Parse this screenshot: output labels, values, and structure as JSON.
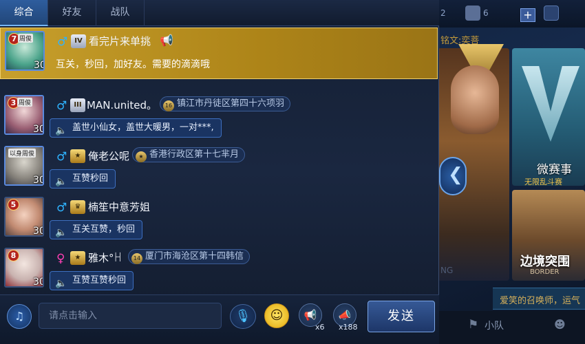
{
  "tabs": [
    {
      "label": "综合",
      "active": true
    },
    {
      "label": "好友",
      "active": false
    },
    {
      "label": "战队",
      "active": false
    }
  ],
  "top_right": {
    "count_a": "2",
    "count_b": "6"
  },
  "lobby": {
    "inscription_label": "铭文:奕菩",
    "tournament_title": "微赛事",
    "tournament_sub": "无限乱斗赛",
    "frontier_title": "边境突围",
    "frontier_en": "BORDER",
    "hidden_word": "赛",
    "hidden_en": "NG",
    "summoner_notice": "爱笑的召唤师，运气",
    "squad_label": "小队"
  },
  "messages": [
    {
      "highlight": true,
      "avatar_level": "30",
      "avatar_tag": "周俊",
      "rank_badge": "7",
      "gender": "♂",
      "gender_color": "#2fb3ff",
      "rank_icon": "IV",
      "nickname": "看完片来单挑",
      "text": "互关，秒回，加好友。需要的滴滴哦"
    },
    {
      "highlight": false,
      "avatar_level": "30",
      "avatar_tag": "周俊",
      "rank_badge": "3",
      "gender": "♂",
      "gender_color": "#2fb3ff",
      "rank_icon": "III",
      "nickname": "MAN.united。",
      "location_icon": "16",
      "location": "镇江市丹徒区第四十六项羽",
      "text": "盖世小仙女，盖世大暖男，一对***,"
    },
    {
      "highlight": false,
      "avatar_level": "30",
      "avatar_tag": "以身周俊",
      "rank_badge": "",
      "gender": "♂",
      "gender_color": "#2fb3ff",
      "rank_icon": "★",
      "nickname": "俺老公呢",
      "location_icon": "★",
      "location": "香港行政区第十七芈月",
      "text": "互赞秒回"
    },
    {
      "highlight": false,
      "avatar_level": "30",
      "avatar_tag": "",
      "rank_badge": "5",
      "gender": "♂",
      "gender_color": "#2fb3ff",
      "rank_icon": "♛",
      "nickname": "楠笙中意芳姐",
      "text": "互关互赞，秒回"
    },
    {
      "highlight": false,
      "avatar_level": "30",
      "avatar_tag": "",
      "rank_badge": "8",
      "gender": "♀",
      "gender_color": "#ff3fb4",
      "rank_icon": "★",
      "nickname": "雅木°ꀿ",
      "location_icon": "14",
      "location": "厦门市海沧区第十四韩信",
      "text": "互赞互赞秒回"
    }
  ],
  "input": {
    "placeholder": "请点击输入",
    "send_label": "发送",
    "horn_small_count": "x6",
    "horn_large_count": "x188"
  },
  "colors": {
    "highlight_bg": "#c79f2c",
    "accent_blue": "#2e5d9e",
    "male": "#2fb3ff",
    "female": "#ff3fb4"
  }
}
